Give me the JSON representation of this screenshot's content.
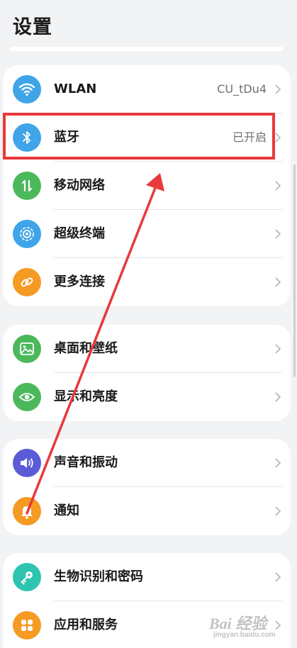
{
  "header": {
    "title": "设置"
  },
  "groups": [
    {
      "items": [
        {
          "label": "WLAN",
          "value": "CU_tDu4",
          "icon": "wifi-icon",
          "color": "#3fa4e8"
        },
        {
          "label": "蓝牙",
          "value": "已开启",
          "icon": "bluetooth-icon",
          "color": "#3fa4e8"
        },
        {
          "label": "移动网络",
          "value": "",
          "icon": "mobile-data-icon",
          "color": "#4cb85c"
        },
        {
          "label": "超级终端",
          "value": "",
          "icon": "super-device-icon",
          "color": "#3fa4e8"
        },
        {
          "label": "更多连接",
          "value": "",
          "icon": "link-icon",
          "color": "#f59a23"
        }
      ]
    },
    {
      "items": [
        {
          "label": "桌面和壁纸",
          "value": "",
          "icon": "wallpaper-icon",
          "color": "#4cb85c"
        },
        {
          "label": "显示和亮度",
          "value": "",
          "icon": "eye-icon",
          "color": "#4cb85c"
        }
      ]
    },
    {
      "items": [
        {
          "label": "声音和振动",
          "value": "",
          "icon": "speaker-icon",
          "color": "#5b5bd8"
        },
        {
          "label": "通知",
          "value": "",
          "icon": "bell-icon",
          "color": "#f59a23"
        }
      ]
    },
    {
      "items": [
        {
          "label": "生物识别和密码",
          "value": "",
          "icon": "key-icon",
          "color": "#2ec4b0"
        },
        {
          "label": "应用和服务",
          "value": "",
          "icon": "apps-icon",
          "color": "#f59a23"
        }
      ]
    }
  ],
  "annotation": {
    "highlight_color": "#e8393b"
  },
  "watermark": {
    "text": "Bai 经验",
    "sub": "jingyan.baidu.com"
  }
}
